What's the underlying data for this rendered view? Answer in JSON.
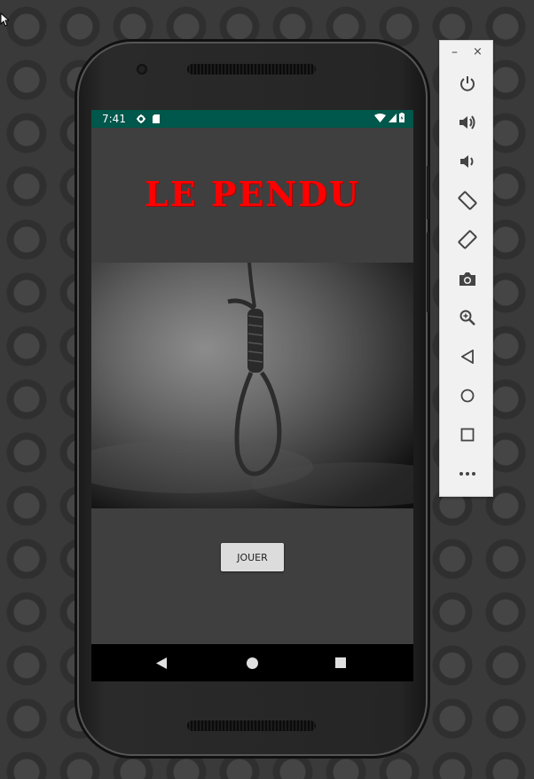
{
  "status_bar": {
    "time": "7:41",
    "icons": [
      "gear-icon",
      "sd-card-icon",
      "wifi-icon",
      "signal-icon",
      "battery-icon"
    ],
    "background_color": "#00574b"
  },
  "app": {
    "title": "LE PENDU",
    "title_color": "#ff0000",
    "image_description_icon": "noose-image",
    "play_button_label": "JOUER",
    "background_color": "#3f3f3f"
  },
  "nav_bar": {
    "icons": [
      "back-icon",
      "home-icon",
      "recent-apps-icon"
    ]
  },
  "emulator_toolbar": {
    "window_controls": {
      "minimize": "–",
      "close": "×"
    },
    "tools": [
      "power-icon",
      "volume-up-icon",
      "volume-down-icon",
      "rotate-left-icon",
      "rotate-right-icon",
      "camera-icon",
      "zoom-icon",
      "back-icon",
      "home-icon",
      "overview-icon",
      "more-icon"
    ]
  }
}
